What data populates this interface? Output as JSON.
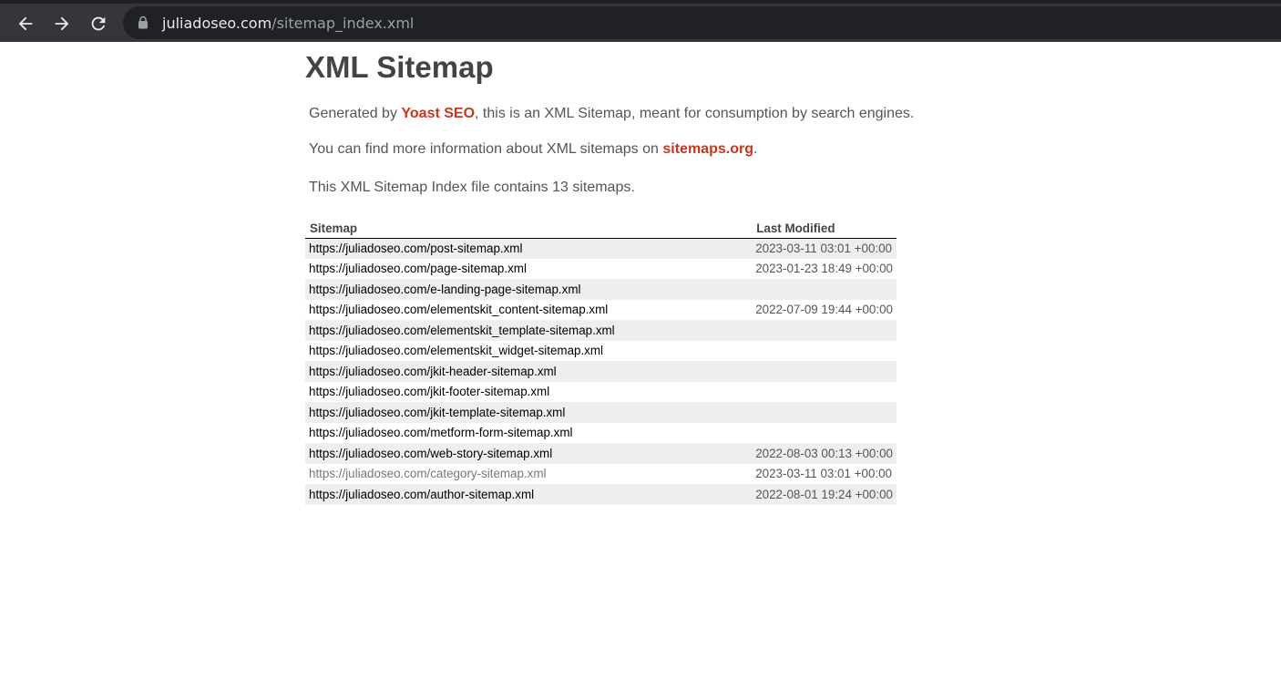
{
  "browser": {
    "url_host": "juliadoseo.com",
    "url_path": "/sitemap_index.xml"
  },
  "page": {
    "title": "XML Sitemap",
    "intro": {
      "prefix": "Generated by ",
      "link_text": "Yoast SEO",
      "suffix": ", this is an XML Sitemap, meant for consumption by search engines."
    },
    "info": {
      "prefix": "You can find more information about XML sitemaps on ",
      "link_text": "sitemaps.org",
      "suffix": "."
    },
    "count_text": "This XML Sitemap Index file contains 13 sitemaps."
  },
  "table": {
    "headers": {
      "sitemap": "Sitemap",
      "last_modified": "Last Modified"
    },
    "rows": [
      {
        "url": "https://juliadoseo.com/post-sitemap.xml",
        "modified": "2023-03-11 03:01 +00:00"
      },
      {
        "url": "https://juliadoseo.com/page-sitemap.xml",
        "modified": "2023-01-23 18:49 +00:00"
      },
      {
        "url": "https://juliadoseo.com/e-landing-page-sitemap.xml",
        "modified": ""
      },
      {
        "url": "https://juliadoseo.com/elementskit_content-sitemap.xml",
        "modified": "2022-07-09 19:44 +00:00"
      },
      {
        "url": "https://juliadoseo.com/elementskit_template-sitemap.xml",
        "modified": ""
      },
      {
        "url": "https://juliadoseo.com/elementskit_widget-sitemap.xml",
        "modified": ""
      },
      {
        "url": "https://juliadoseo.com/jkit-header-sitemap.xml",
        "modified": ""
      },
      {
        "url": "https://juliadoseo.com/jkit-footer-sitemap.xml",
        "modified": ""
      },
      {
        "url": "https://juliadoseo.com/jkit-template-sitemap.xml",
        "modified": ""
      },
      {
        "url": "https://juliadoseo.com/metform-form-sitemap.xml",
        "modified": ""
      },
      {
        "url": "https://juliadoseo.com/web-story-sitemap.xml",
        "modified": "2022-08-03 00:13 +00:00"
      },
      {
        "url": "https://juliadoseo.com/category-sitemap.xml",
        "modified": "2023-03-11 03:01 +00:00",
        "visited": true
      },
      {
        "url": "https://juliadoseo.com/author-sitemap.xml",
        "modified": "2022-08-01 19:24 +00:00"
      }
    ]
  }
}
